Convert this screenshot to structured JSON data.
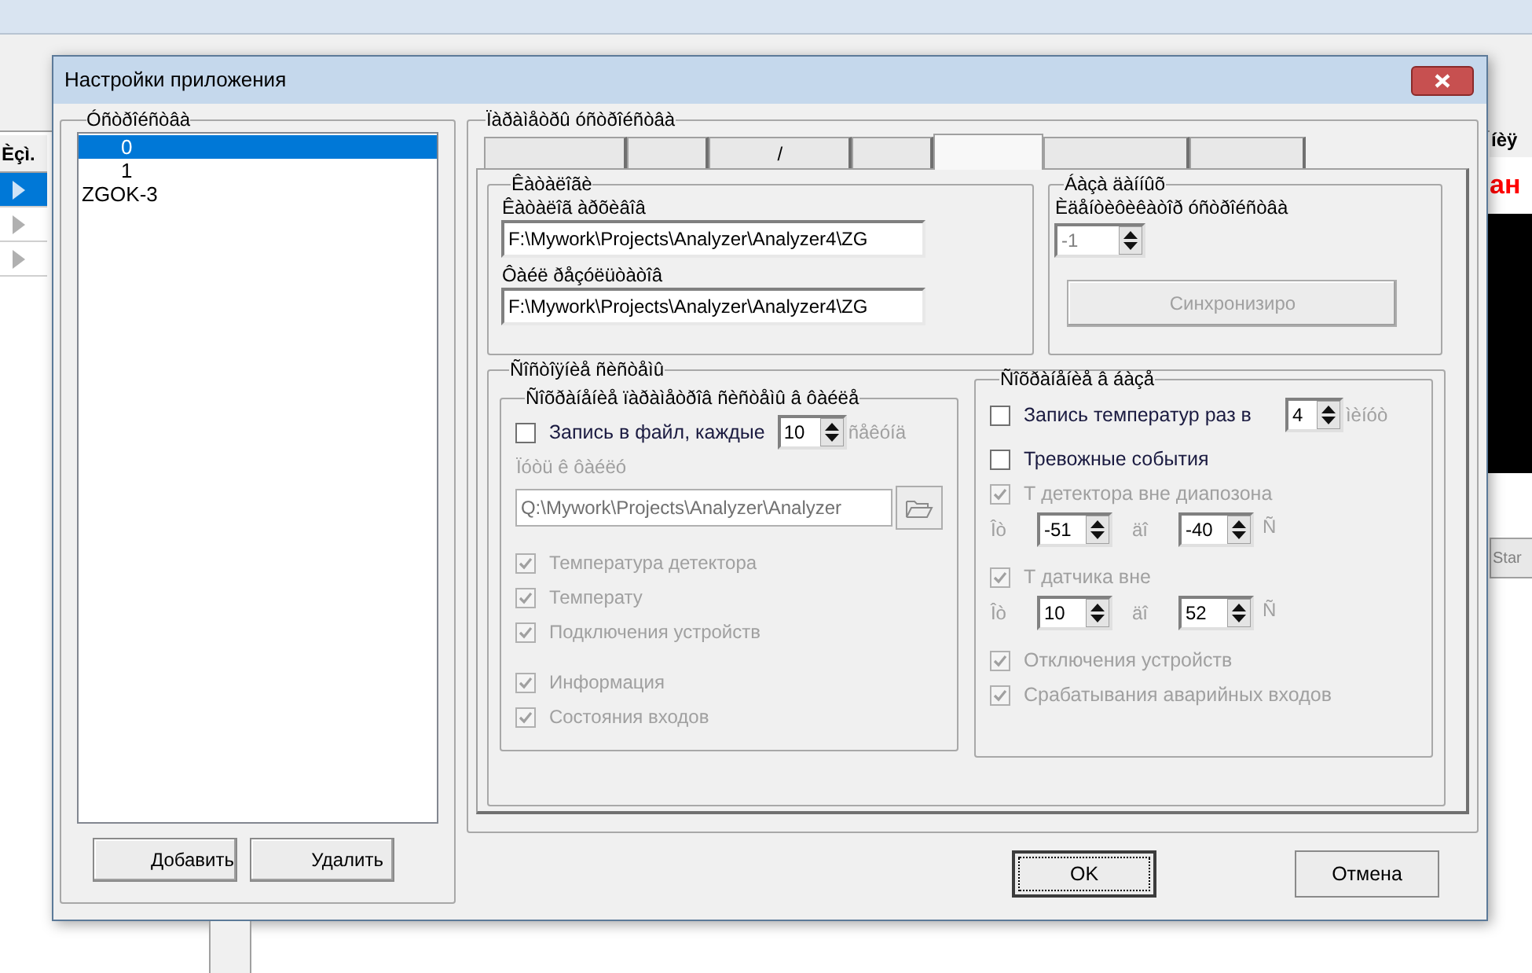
{
  "background": {
    "column_header": "Èçì.",
    "rows": [
      {
        "selected": true
      },
      {
        "selected": false
      },
      {
        "selected": false
      }
    ],
    "header_fragment": "íèÿ",
    "red_text": "ан",
    "start_button": "Star"
  },
  "window": {
    "title": "Настройки приложения"
  },
  "devices": {
    "title": "Óñòðîéñòâà",
    "items": [
      {
        "label": "0",
        "kind": "channel",
        "selected": true
      },
      {
        "label": "1",
        "kind": "channel",
        "selected": false
      },
      {
        "label": "ZGOK-3",
        "kind": "device",
        "selected": false
      }
    ],
    "add_button": "Добавить",
    "delete_button": "Удалить"
  },
  "settings": {
    "title": "Ïàðàìåòðû óñòðîéñòâà",
    "tabs": [
      {
        "selected": false
      },
      {
        "selected": false
      },
      {
        "label": "/",
        "selected": false
      },
      {
        "selected": false
      },
      {
        "selected": true
      },
      {
        "selected": false
      },
      {
        "selected": false
      }
    ],
    "catalogs": {
      "title": "Êàòàëîãè",
      "fields": [
        {
          "label": "Êàòàëîã àðõèâîâ",
          "value": "F:\\Mywork\\Projects\\Analyzer\\Analyzer4\\ZG"
        },
        {
          "label": "Ôàéë ðåçóëüòàòîâ",
          "value": "F:\\Mywork\\Projects\\Analyzer\\Analyzer4\\ZG"
        }
      ]
    },
    "database": {
      "title": "Áàçà äàííûõ",
      "id_label": "Èäåíòèôèêàòîð óñòðîéñòâà",
      "id_value": "-1",
      "sync_button": {
        "label": "Синхронизиро",
        "disabled": true
      }
    },
    "system": {
      "title": "Ñîñòîÿíèå ñèñòåìû",
      "file_save": {
        "title": "Ñîõðàíåíèå ïàðàìåòðîâ ñèñòåìû â ôàéëå",
        "write": {
          "label": "Запись в файл, каждые",
          "checked": false,
          "value": "10",
          "unit": "ñåêóíä"
        },
        "path_label": "Ïóòü ê ôàéëó",
        "path_value": "Q:\\Mywork\\Projects\\Analyzer\\Analyzer",
        "options": [
          {
            "label": "Температура детектора",
            "checked": true,
            "disabled": true
          },
          {
            "label": "Температу",
            "checked": true,
            "disabled": true
          },
          {
            "label": "Подключения устройств",
            "checked": true,
            "disabled": true
          },
          {
            "label": "Информация",
            "checked": true,
            "disabled": true
          },
          {
            "label": "Состояния входов",
            "checked": true,
            "disabled": true
          }
        ]
      },
      "db_save": {
        "title": "Ñîõðàíåíèå â áàçå",
        "rows": [
          {
            "kind": "checkbox",
            "label": "Запись температур раз в",
            "checked": false,
            "disabled": false,
            "value": "4",
            "unit": "ìèíóò"
          },
          {
            "kind": "checkbox",
            "label": "Тревожные события",
            "checked": false,
            "disabled": false
          },
          {
            "kind": "checkbox",
            "label": "Т детектора вне диапозона",
            "checked": true,
            "disabled": true
          },
          {
            "kind": "range",
            "from_label": "Îò",
            "from": "-51",
            "to_label": "äî",
            "to": "-40",
            "unit": "Ñ"
          },
          {
            "kind": "checkbox",
            "label": "Т датчика вне",
            "checked": true,
            "disabled": true
          },
          {
            "kind": "range",
            "from_label": "Îò",
            "from": "10",
            "to_label": "äî",
            "to": "52",
            "unit": "Ñ"
          },
          {
            "kind": "checkbox",
            "label": "Отключения устройств",
            "checked": true,
            "disabled": true
          },
          {
            "kind": "checkbox",
            "label": "Срабатывания аварийных входов",
            "checked": true,
            "disabled": true
          }
        ]
      }
    }
  },
  "buttons": [
    {
      "label": "OK",
      "focused": true
    },
    {
      "label": "Отмена",
      "focused": false
    }
  ]
}
